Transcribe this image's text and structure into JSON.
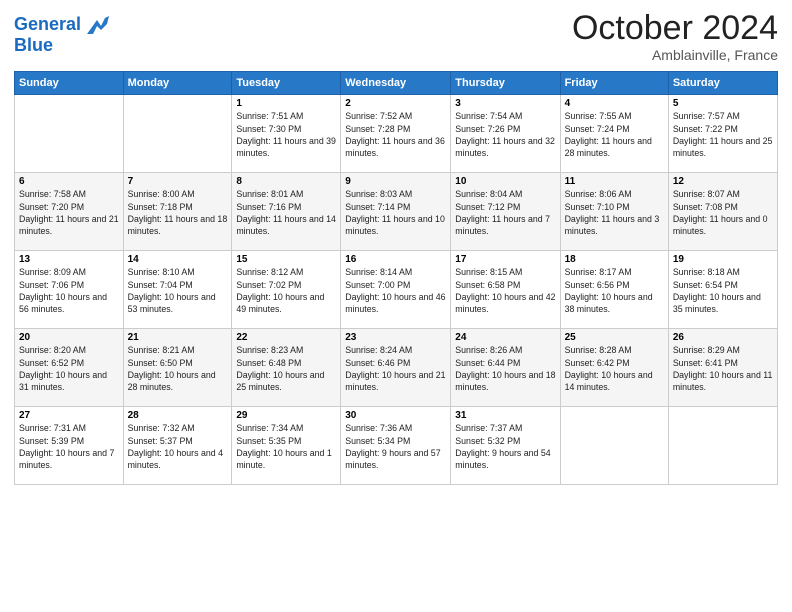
{
  "header": {
    "logo_line1": "General",
    "logo_line2": "Blue",
    "month": "October 2024",
    "location": "Amblainville, France"
  },
  "weekdays": [
    "Sunday",
    "Monday",
    "Tuesday",
    "Wednesday",
    "Thursday",
    "Friday",
    "Saturday"
  ],
  "weeks": [
    [
      {
        "day": "",
        "info": ""
      },
      {
        "day": "",
        "info": ""
      },
      {
        "day": "1",
        "info": "Sunrise: 7:51 AM\nSunset: 7:30 PM\nDaylight: 11 hours and 39 minutes."
      },
      {
        "day": "2",
        "info": "Sunrise: 7:52 AM\nSunset: 7:28 PM\nDaylight: 11 hours and 36 minutes."
      },
      {
        "day": "3",
        "info": "Sunrise: 7:54 AM\nSunset: 7:26 PM\nDaylight: 11 hours and 32 minutes."
      },
      {
        "day": "4",
        "info": "Sunrise: 7:55 AM\nSunset: 7:24 PM\nDaylight: 11 hours and 28 minutes."
      },
      {
        "day": "5",
        "info": "Sunrise: 7:57 AM\nSunset: 7:22 PM\nDaylight: 11 hours and 25 minutes."
      }
    ],
    [
      {
        "day": "6",
        "info": "Sunrise: 7:58 AM\nSunset: 7:20 PM\nDaylight: 11 hours and 21 minutes."
      },
      {
        "day": "7",
        "info": "Sunrise: 8:00 AM\nSunset: 7:18 PM\nDaylight: 11 hours and 18 minutes."
      },
      {
        "day": "8",
        "info": "Sunrise: 8:01 AM\nSunset: 7:16 PM\nDaylight: 11 hours and 14 minutes."
      },
      {
        "day": "9",
        "info": "Sunrise: 8:03 AM\nSunset: 7:14 PM\nDaylight: 11 hours and 10 minutes."
      },
      {
        "day": "10",
        "info": "Sunrise: 8:04 AM\nSunset: 7:12 PM\nDaylight: 11 hours and 7 minutes."
      },
      {
        "day": "11",
        "info": "Sunrise: 8:06 AM\nSunset: 7:10 PM\nDaylight: 11 hours and 3 minutes."
      },
      {
        "day": "12",
        "info": "Sunrise: 8:07 AM\nSunset: 7:08 PM\nDaylight: 11 hours and 0 minutes."
      }
    ],
    [
      {
        "day": "13",
        "info": "Sunrise: 8:09 AM\nSunset: 7:06 PM\nDaylight: 10 hours and 56 minutes."
      },
      {
        "day": "14",
        "info": "Sunrise: 8:10 AM\nSunset: 7:04 PM\nDaylight: 10 hours and 53 minutes."
      },
      {
        "day": "15",
        "info": "Sunrise: 8:12 AM\nSunset: 7:02 PM\nDaylight: 10 hours and 49 minutes."
      },
      {
        "day": "16",
        "info": "Sunrise: 8:14 AM\nSunset: 7:00 PM\nDaylight: 10 hours and 46 minutes."
      },
      {
        "day": "17",
        "info": "Sunrise: 8:15 AM\nSunset: 6:58 PM\nDaylight: 10 hours and 42 minutes."
      },
      {
        "day": "18",
        "info": "Sunrise: 8:17 AM\nSunset: 6:56 PM\nDaylight: 10 hours and 38 minutes."
      },
      {
        "day": "19",
        "info": "Sunrise: 8:18 AM\nSunset: 6:54 PM\nDaylight: 10 hours and 35 minutes."
      }
    ],
    [
      {
        "day": "20",
        "info": "Sunrise: 8:20 AM\nSunset: 6:52 PM\nDaylight: 10 hours and 31 minutes."
      },
      {
        "day": "21",
        "info": "Sunrise: 8:21 AM\nSunset: 6:50 PM\nDaylight: 10 hours and 28 minutes."
      },
      {
        "day": "22",
        "info": "Sunrise: 8:23 AM\nSunset: 6:48 PM\nDaylight: 10 hours and 25 minutes."
      },
      {
        "day": "23",
        "info": "Sunrise: 8:24 AM\nSunset: 6:46 PM\nDaylight: 10 hours and 21 minutes."
      },
      {
        "day": "24",
        "info": "Sunrise: 8:26 AM\nSunset: 6:44 PM\nDaylight: 10 hours and 18 minutes."
      },
      {
        "day": "25",
        "info": "Sunrise: 8:28 AM\nSunset: 6:42 PM\nDaylight: 10 hours and 14 minutes."
      },
      {
        "day": "26",
        "info": "Sunrise: 8:29 AM\nSunset: 6:41 PM\nDaylight: 10 hours and 11 minutes."
      }
    ],
    [
      {
        "day": "27",
        "info": "Sunrise: 7:31 AM\nSunset: 5:39 PM\nDaylight: 10 hours and 7 minutes."
      },
      {
        "day": "28",
        "info": "Sunrise: 7:32 AM\nSunset: 5:37 PM\nDaylight: 10 hours and 4 minutes."
      },
      {
        "day": "29",
        "info": "Sunrise: 7:34 AM\nSunset: 5:35 PM\nDaylight: 10 hours and 1 minute."
      },
      {
        "day": "30",
        "info": "Sunrise: 7:36 AM\nSunset: 5:34 PM\nDaylight: 9 hours and 57 minutes."
      },
      {
        "day": "31",
        "info": "Sunrise: 7:37 AM\nSunset: 5:32 PM\nDaylight: 9 hours and 54 minutes."
      },
      {
        "day": "",
        "info": ""
      },
      {
        "day": "",
        "info": ""
      }
    ]
  ]
}
